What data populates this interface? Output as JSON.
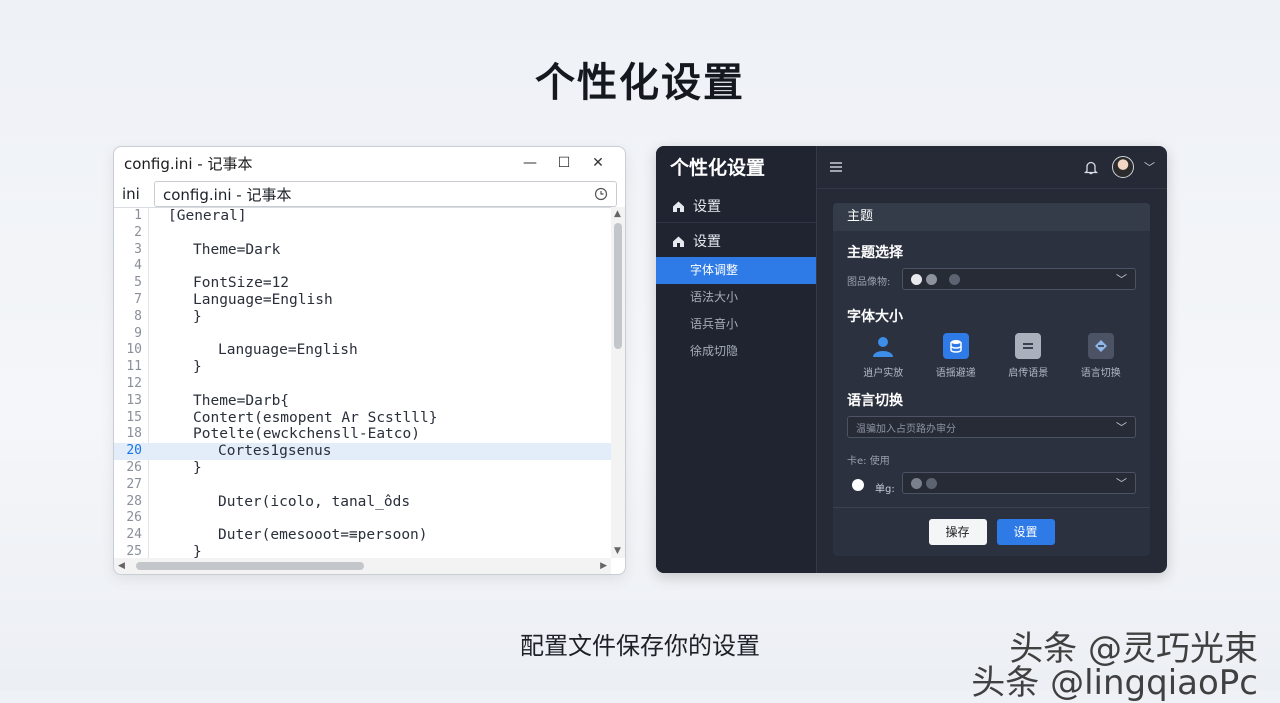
{
  "page": {
    "title": "个性化设置",
    "caption": "配置文件保存你的设置",
    "watermark_line1": "头条 @灵巧光束",
    "watermark_line2": "头条 @lingqiaoPc"
  },
  "notepad": {
    "title": "config.ini - 记事本",
    "ext_label": "ini",
    "path_value": "config.ini - 记事本",
    "minimize": "—",
    "maximize": "☐",
    "close": "✕",
    "lines": [
      {
        "n": "1",
        "t": "[General]",
        "indent": 0
      },
      {
        "n": "2",
        "t": "",
        "indent": 0
      },
      {
        "n": "3",
        "t": "Theme=Dark",
        "indent": 1
      },
      {
        "n": "4",
        "t": "",
        "indent": 0
      },
      {
        "n": "5",
        "t": "FontSize=12",
        "indent": 1
      },
      {
        "n": "7",
        "t": "Language=English",
        "indent": 1
      },
      {
        "n": "8",
        "t": "}",
        "indent": 1
      },
      {
        "n": "9",
        "t": "",
        "indent": 0
      },
      {
        "n": "10",
        "t": "Language=English",
        "indent": 2
      },
      {
        "n": "11",
        "t": "}",
        "indent": 1
      },
      {
        "n": "12",
        "t": "",
        "indent": 0
      },
      {
        "n": "13",
        "t": "Theme=Darb{",
        "indent": 1
      },
      {
        "n": "15",
        "t": "Contert(esmopent Ar Scstlll}",
        "indent": 1
      },
      {
        "n": "18",
        "t": "Potelte(ewckchensll-Eatco)",
        "indent": 1
      },
      {
        "n": "20",
        "t": "Cortes1gsenus",
        "indent": 2,
        "active": true
      },
      {
        "n": "26",
        "t": "}",
        "indent": 1
      },
      {
        "n": "27",
        "t": "",
        "indent": 0
      },
      {
        "n": "28",
        "t": "Duter(icolo, tanal_ôds",
        "indent": 2
      },
      {
        "n": "26",
        "t": "",
        "indent": 0
      },
      {
        "n": "24",
        "t": "Duter(emesooot=≡persoon)",
        "indent": 2
      },
      {
        "n": "25",
        "t": "}",
        "indent": 1
      }
    ]
  },
  "app": {
    "title": "个性化设置",
    "nav": [
      {
        "label": "设置"
      },
      {
        "label": "设置"
      }
    ],
    "sub_items": [
      {
        "label": "字体调整",
        "active": true
      },
      {
        "label": "语法大小",
        "active": false
      },
      {
        "label": "语兵音小",
        "active": false
      },
      {
        "label": "徐成切隐",
        "active": false
      }
    ],
    "panel_header": "主题",
    "theme_section": "主题选择",
    "theme_field_label": "图品像物:",
    "font_section": "字体大小",
    "font_options": [
      {
        "label": "逍户实放",
        "icon": "user-icon",
        "color": "#3d8ee8"
      },
      {
        "label": "语揺避递",
        "icon": "database-icon",
        "color": "#2e7ae6"
      },
      {
        "label": "启传语景",
        "icon": "list-icon",
        "color": "#aab1bd"
      },
      {
        "label": "语言切换",
        "icon": "translate-icon",
        "color": "#8fb8e8"
      }
    ],
    "lang_section": "语言切换",
    "lang_placeholder": "温骗加入占页路办审分",
    "use_label": "卡e: 使用",
    "radio_label": "单g:",
    "save_button": "操存",
    "settings_button": "设置",
    "colors": {
      "accent": "#2e7ae6",
      "bg": "#252a36",
      "sidebar": "#1f2430"
    }
  }
}
